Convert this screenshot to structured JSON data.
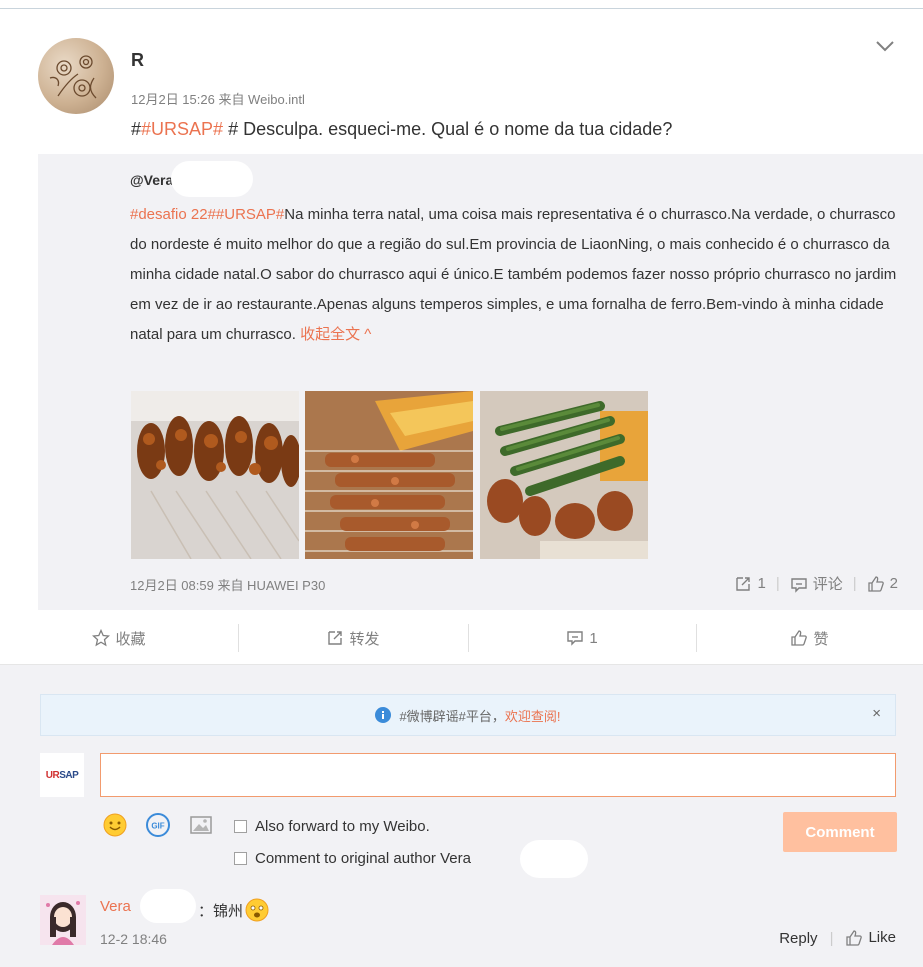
{
  "post": {
    "username": "R",
    "meta": "12月2日 15:26 来自 Weibo.intl",
    "text_prefix": "#",
    "tag": "#URSAP#",
    "text_rest": " # Desculpa. esqueci-me. Qual é o nome da tua cidade?"
  },
  "repost": {
    "username": "@Vera",
    "tags": "#desafio 22##URSAP#",
    "body": "Na minha terra natal, uma coisa mais representativa é o churrasco.Na verdade, o churrasco do nordeste é muito melhor do que a região do sul.Em provincia de LiaonNing, o mais conhecido é o churrasco da minha cidade natal.O sabor do churrasco aqui é único.E também podemos fazer nosso próprio churrasco no jardim em vez de ir ao restaurante.Apenas alguns temperos simples, e uma fornalha de ferro.Bem-vindo à minha cidade natal para um churrasco.",
    "collapse_label": "收起全文 ^",
    "meta": "12月2日 08:59 来自 HUAWEI P30",
    "forward_count": "1",
    "comment_label": "评论",
    "like_count": "2"
  },
  "actions": {
    "favorite": "收藏",
    "forward": "转发",
    "comment_count": "1",
    "like": "赞"
  },
  "notice": {
    "text": "#微博辟谣#平台，",
    "link": "欢迎查阅!",
    "close": "×"
  },
  "composer": {
    "avatar_text_a": "UR",
    "avatar_text_b": "SAP",
    "input_value": "",
    "forward_label": "Also forward to my Weibo.",
    "original_label": "Comment to original author Vera",
    "submit_label": "Comment"
  },
  "comment": {
    "name": "Vera",
    "text": "：锦州",
    "time": "12-2 18:46",
    "reply": "Reply",
    "like": "Like"
  },
  "colors": {
    "accent": "#eb7350",
    "muted": "#808080",
    "panel": "#f2f2f5",
    "button_disabled": "#ffc09f"
  }
}
